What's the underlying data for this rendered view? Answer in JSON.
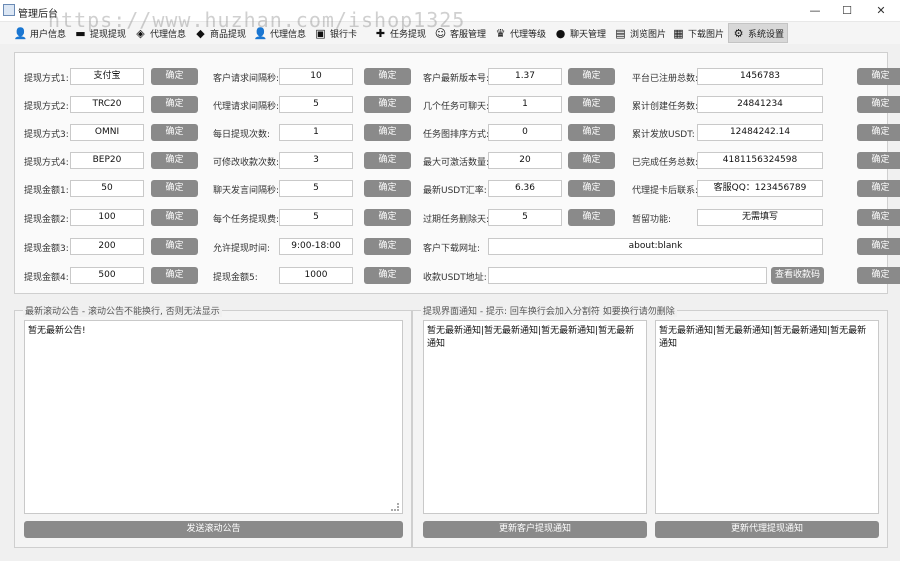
{
  "window": {
    "title": "管理后台",
    "watermark": "https://www.huzhan.com/ishop1325",
    "minimize": "—",
    "maximize": "☐",
    "close": "✕"
  },
  "toolbar": [
    {
      "label": "用户信息",
      "icon": "user-icon"
    },
    {
      "label": "提现提现",
      "icon": "card-icon"
    },
    {
      "label": "代理信息",
      "icon": "shield-icon"
    },
    {
      "label": "商品提现",
      "icon": "box-icon"
    },
    {
      "label": "代理信息",
      "icon": "agent-icon"
    },
    {
      "label": "银行卡",
      "icon": "shop-icon"
    },
    {
      "label": "任务提现",
      "icon": "task-icon"
    },
    {
      "label": "客服管理",
      "icon": "support-icon"
    },
    {
      "label": "代理等级",
      "icon": "crown-icon"
    },
    {
      "label": "聊天管理",
      "icon": "chat-icon"
    },
    {
      "label": "浏览图片",
      "icon": "image-icon"
    },
    {
      "label": "下载图片",
      "icon": "download-icon"
    },
    {
      "label": "系统设置",
      "icon": "gear-icon"
    }
  ],
  "confirm_label": "确定",
  "col1": [
    {
      "label": "提现方式1:",
      "value": "支付宝"
    },
    {
      "label": "提现方式2:",
      "value": "TRC20"
    },
    {
      "label": "提现方式3:",
      "value": "OMNI"
    },
    {
      "label": "提现方式4:",
      "value": "BEP20"
    },
    {
      "label": "提现金额1:",
      "value": "50"
    },
    {
      "label": "提现金额2:",
      "value": "100"
    },
    {
      "label": "提现金额3:",
      "value": "200"
    },
    {
      "label": "提现金额4:",
      "value": "500"
    }
  ],
  "col2": [
    {
      "label": "客户请求间隔秒:",
      "value": "10"
    },
    {
      "label": "代理请求间隔秒:",
      "value": "5"
    },
    {
      "label": "每日提现次数:",
      "value": "1"
    },
    {
      "label": "可修改收款次数:",
      "value": "3"
    },
    {
      "label": "聊天发言间隔秒:",
      "value": "5"
    },
    {
      "label": "每个任务提现费:",
      "value": "5"
    },
    {
      "label": "允许提现时间:",
      "value": "9:00-18:00"
    },
    {
      "label": "提现金额5:",
      "value": "1000"
    }
  ],
  "col3": [
    {
      "label": "客户最新版本号:",
      "value": "1.37"
    },
    {
      "label": "几个任务可聊天:",
      "value": "1"
    },
    {
      "label": "任务图排序方式:",
      "value": "0"
    },
    {
      "label": "最大可激活数量:",
      "value": "20"
    },
    {
      "label": "最新USDT汇率:",
      "value": "6.36"
    },
    {
      "label": "过期任务删除天:",
      "value": "5"
    }
  ],
  "col4": [
    {
      "label": "平台已注册总数:",
      "value": "1456783"
    },
    {
      "label": "累计创建任务数:",
      "value": "24841234"
    },
    {
      "label": "累计发放USDT:",
      "value": "12484242.14"
    },
    {
      "label": "已完成任务总数:",
      "value": "4181156324598"
    },
    {
      "label": "代理提卡后联系:",
      "value": "客服QQ：123456789"
    },
    {
      "label": "暂留功能:",
      "value": "无需填写"
    }
  ],
  "download_url": {
    "label": "客户下载网址:",
    "value": "about:blank"
  },
  "usdt_address": {
    "label": "收款USDT地址:",
    "value": "",
    "view_qr": "查看收款码"
  },
  "announcement": {
    "legend": "最新滚动公告 - 滚动公告不能换行, 否则无法显示",
    "text": "暂无最新公告!",
    "button": "发送滚动公告"
  },
  "notice": {
    "legend": "提现界面通知 - 提示: 回车换行会加入分割符 如要换行请勿删除",
    "customer_text": "暂无最新通知|暂无最新通知|暂无最新通知|暂无最新通知",
    "agent_text": "暂无最新通知|暂无最新通知|暂无最新通知|暂无最新通知",
    "customer_button": "更新客户提现通知",
    "agent_button": "更新代理提现通知"
  }
}
